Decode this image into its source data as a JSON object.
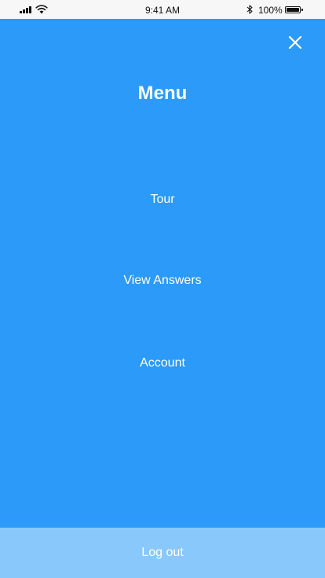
{
  "status_bar": {
    "time": "9:41 AM",
    "battery_percent": "100%",
    "icons": [
      "signal-icon",
      "wifi-icon",
      "bluetooth-icon",
      "battery-icon"
    ],
    "battery_level": 1.0
  },
  "menu": {
    "title": "Menu",
    "close_icon": "close-icon",
    "items": [
      {
        "label": "Tour"
      },
      {
        "label": "View Answers"
      },
      {
        "label": "Account"
      }
    ],
    "logout_label": "Log out"
  },
  "colors": {
    "background": "#2b9af8",
    "logout_bar": "#89c8fa",
    "text": "#ffffff",
    "status_bar": "#f7f7f7"
  }
}
